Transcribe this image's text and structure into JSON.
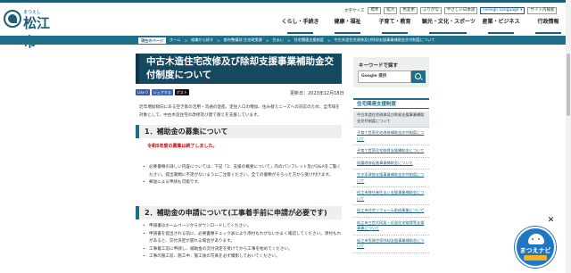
{
  "header": {
    "logo_ruby": "まつえし",
    "logo_name": "松江市",
    "utility": {
      "font_size_label": "文字サイズ",
      "buttons": [
        "標準",
        "拡大",
        "色変更",
        "ふりがな",
        "やさしい日本語",
        "Foreign Language ▾",
        "サイト内検索"
      ]
    },
    "gnav": [
      "くらし・手続き",
      "健康・福祉",
      "子育て・教育",
      "観光・文化・スポーツ",
      "産業・ビジネス",
      "行政情報"
    ]
  },
  "breadcrumb": {
    "current_label": "現在のページ",
    "items": [
      "ホーム",
      "組織から探す",
      "都市整備部 住宅政策課",
      "住まい",
      "住宅関連支援制度",
      "中古木造住宅改修及び除却支援事業補助金交付制度について"
    ]
  },
  "main": {
    "title": "中古木造住宅改修及び除却支援事業補助金交付制度について",
    "share": {
      "like": "Like 0",
      "fb_share": "シェアする",
      "post": "ポスト"
    },
    "updated": "更新日：2023年12月18日",
    "lead": "近年増加傾向にある空き家の活用・流通の促進、定住人口の増加、住み替えニーズへの対応のため、全市域を対象として、中古木造住宅の改修及び建て替えを支援しています。",
    "section1_heading": "1．補助金の募集について",
    "notice": "令和5年度の募集は終了しました。",
    "section1_bullets": [
      "必要書類の詳しい内容については、下記「3．支援の概要について」内のパンフレット及びQ&Aをご覧ください。提出書類に不足がないようにご注意ください。全ての書類がそろった方から受け付けます。",
      "郵送による申請も可能です。"
    ],
    "section2_heading": "2．補助金の申請について(工事着手前に申請が必要です)",
    "section2_bullets": [
      "申請書はホームページからダウンロードしてください。",
      "申請書を提出される前に、必要書類チェック表により添付もれがないかよく確認してください。添付もれがあると、交付決定が遅れる場合があります。",
      "工事着工前に申請し、補助金の交付決定を受けてから工事を始めてください。",
      "工事の施工前、施工中、施工後の写真を必ず撮影しておいてください。"
    ]
  },
  "sidebar": {
    "search_label": "キーワードで探す",
    "search_box_text": "Google 提供",
    "related_heading": "住宅関連支援制度",
    "related_items": [
      "中古木造住宅改修及び除却支援事業補助金交付制度について",
      "子育て世帯住宅改修補助金交付制度について",
      "子育て世帯住宅取得支援補助金について",
      "耐震改修促進事業補助金について",
      "空き家改修支援事業補助金交付制度について",
      "松江市移住者住まい支援事業補助金について",
      "松江市住宅リフォーム助成事業について",
      "松江市三世代同居・近居住宅取得等支援事業について",
      "松江市危険空家除却支援事業補助金について"
    ]
  },
  "widget": {
    "label": "まつえナビ",
    "close": "✕"
  },
  "colors": {
    "brand": "#1b5e7a",
    "title_bg": "#16485f",
    "notice": "#d40000",
    "widget": "#1f77c4"
  }
}
